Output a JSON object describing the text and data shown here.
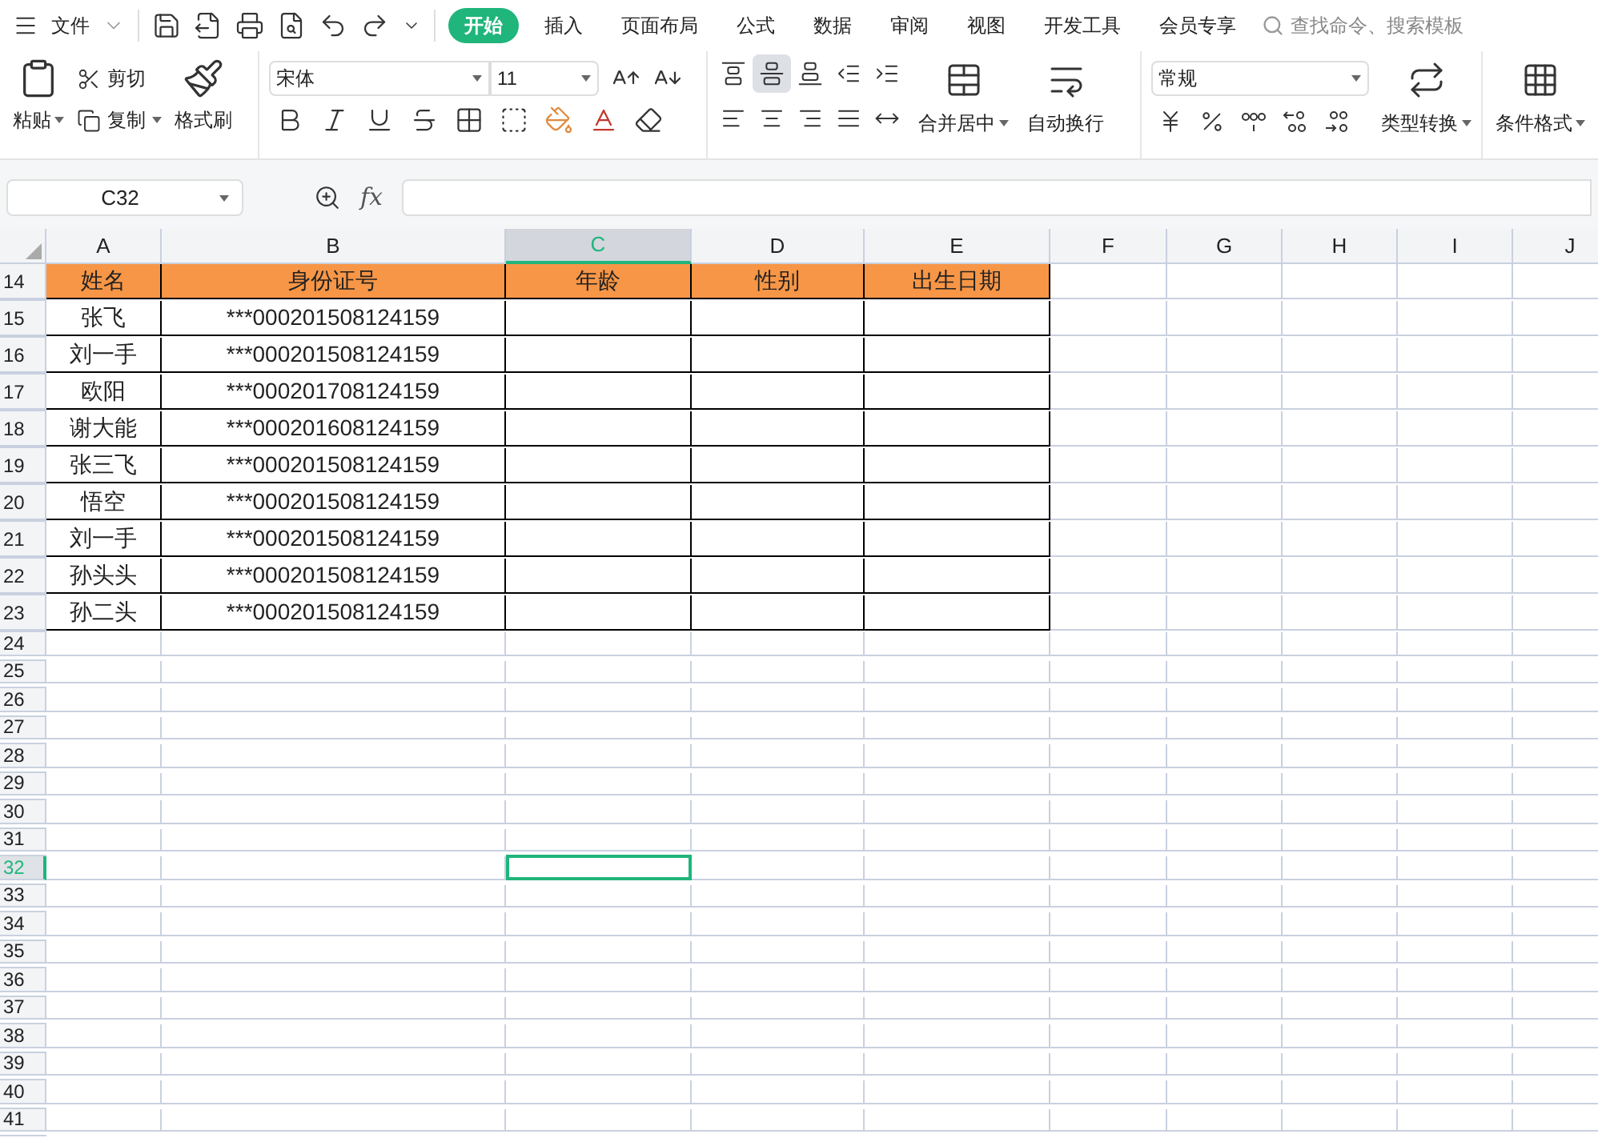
{
  "menu": {
    "file": "文件",
    "tabs": [
      {
        "label": "开始",
        "selected": true
      },
      {
        "label": "插入",
        "selected": false
      },
      {
        "label": "页面布局",
        "selected": false
      },
      {
        "label": "公式",
        "selected": false
      },
      {
        "label": "数据",
        "selected": false
      },
      {
        "label": "审阅",
        "selected": false
      },
      {
        "label": "视图",
        "selected": false
      },
      {
        "label": "开发工具",
        "selected": false
      },
      {
        "label": "会员专享",
        "selected": false
      }
    ],
    "search": {
      "placeholder": "查找命令、搜索模板"
    }
  },
  "ribbon": {
    "paste": "粘贴",
    "cut": "剪切",
    "copy": "复制",
    "format_painter": "格式刷",
    "font": "宋体",
    "font_size": "11",
    "merge": "合并居中",
    "wrap": "自动换行",
    "number_format": "常规",
    "convert": "类型转换",
    "conditional_format": "条件格式"
  },
  "formula_bar": {
    "name_box": "C32",
    "fx": "fx"
  },
  "sheet": {
    "columns": [
      {
        "label": "A",
        "selected": false
      },
      {
        "label": "B",
        "selected": false
      },
      {
        "label": "C",
        "selected": true
      },
      {
        "label": "D",
        "selected": false
      },
      {
        "label": "E",
        "selected": false
      },
      {
        "label": "F",
        "selected": false
      },
      {
        "label": "G",
        "selected": false
      },
      {
        "label": "H",
        "selected": false
      },
      {
        "label": "I",
        "selected": false
      },
      {
        "label": "J",
        "selected": false
      }
    ],
    "rows": [
      {
        "number": "14",
        "kind": "header",
        "selected": false,
        "cells": [
          "姓名",
          "身份证号",
          "年龄",
          "性别",
          "出生日期"
        ]
      },
      {
        "number": "15",
        "kind": "data",
        "selected": false,
        "cells": [
          "张飞",
          "***000201508124159"
        ]
      },
      {
        "number": "16",
        "kind": "data",
        "selected": false,
        "cells": [
          "刘一手",
          "***000201508124159"
        ]
      },
      {
        "number": "17",
        "kind": "data",
        "selected": false,
        "cells": [
          "欧阳",
          "***000201708124159"
        ]
      },
      {
        "number": "18",
        "kind": "data",
        "selected": false,
        "cells": [
          "谢大能",
          "***000201608124159"
        ]
      },
      {
        "number": "19",
        "kind": "data",
        "selected": false,
        "cells": [
          "张三飞",
          "***000201508124159"
        ]
      },
      {
        "number": "20",
        "kind": "data",
        "selected": false,
        "cells": [
          "悟空",
          "***000201508124159"
        ]
      },
      {
        "number": "21",
        "kind": "data",
        "selected": false,
        "cells": [
          "刘一手",
          "***000201508124159"
        ]
      },
      {
        "number": "22",
        "kind": "data",
        "selected": false,
        "cells": [
          "孙头头",
          "***000201508124159"
        ]
      },
      {
        "number": "23",
        "kind": "data",
        "selected": false,
        "cells": [
          "孙二头",
          "***000201508124159"
        ]
      },
      {
        "number": "24",
        "kind": "blank",
        "selected": false
      },
      {
        "number": "25",
        "kind": "blank",
        "selected": false
      },
      {
        "number": "26",
        "kind": "blank",
        "selected": false
      },
      {
        "number": "27",
        "kind": "blank",
        "selected": false
      },
      {
        "number": "28",
        "kind": "blank",
        "selected": false
      },
      {
        "number": "29",
        "kind": "blank",
        "selected": false
      },
      {
        "number": "30",
        "kind": "blank",
        "selected": false
      },
      {
        "number": "31",
        "kind": "blank",
        "selected": false
      },
      {
        "number": "32",
        "kind": "blank",
        "selected": true
      },
      {
        "number": "33",
        "kind": "blank",
        "selected": false
      },
      {
        "number": "34",
        "kind": "blank",
        "selected": false
      },
      {
        "number": "35",
        "kind": "blank",
        "selected": false
      },
      {
        "number": "36",
        "kind": "blank",
        "selected": false
      },
      {
        "number": "37",
        "kind": "blank",
        "selected": false
      },
      {
        "number": "38",
        "kind": "blank",
        "selected": false
      },
      {
        "number": "39",
        "kind": "blank",
        "selected": false
      },
      {
        "number": "40",
        "kind": "blank",
        "selected": false
      },
      {
        "number": "41",
        "kind": "blank",
        "selected": false
      }
    ]
  }
}
